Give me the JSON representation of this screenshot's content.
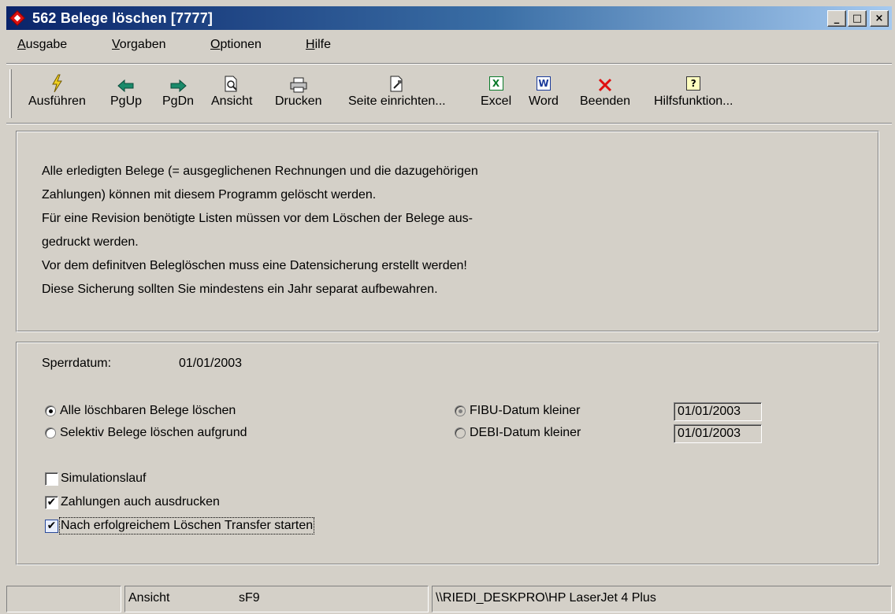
{
  "window": {
    "title": "562 Belege löschen [7777]",
    "controls": {
      "minimize": "_",
      "maximize": "□",
      "close": "×"
    }
  },
  "menu": {
    "items": [
      {
        "label": "Ausgabe",
        "accel": "A",
        "rest": "usgabe"
      },
      {
        "label": "Vorgaben",
        "accel": "V",
        "rest": "orgaben"
      },
      {
        "label": "Optionen",
        "accel": "O",
        "rest": "ptionen"
      },
      {
        "label": "Hilfe",
        "accel": "H",
        "rest": "ilfe"
      }
    ]
  },
  "toolbar": {
    "buttons": [
      {
        "label": "Ausführen",
        "icon": "lightning-icon"
      },
      {
        "label": "PgUp",
        "icon": "arrow-left-icon"
      },
      {
        "label": "PgDn",
        "icon": "arrow-right-icon"
      },
      {
        "label": "Ansicht",
        "icon": "print-preview-icon"
      },
      {
        "label": "Drucken",
        "icon": "printer-icon"
      },
      {
        "label": "Seite einrichten...",
        "icon": "page-setup-icon"
      },
      {
        "label": "Excel",
        "icon": "excel-icon"
      },
      {
        "label": "Word",
        "icon": "word-icon"
      },
      {
        "label": "Beenden",
        "icon": "close-x-icon"
      },
      {
        "label": "Hilfsfunktion...",
        "icon": "help-icon"
      }
    ],
    "colors": {
      "arrow": "#0a7a5a",
      "beenden": "#e01010",
      "lightning": "#c8a000"
    }
  },
  "info": {
    "lines": [
      "Alle erledigten Belege (= ausgeglichenen Rechnungen und die dazugehörigen",
      "Zahlungen) können mit diesem Programm gelöscht werden.",
      "Für eine Revision benötigte Listen müssen vor dem Löschen der Belege aus-",
      "gedruckt werden.",
      "Vor dem definitven Beleglöschen muss eine Datensicherung erstellt werden!",
      "Diese Sicherung sollten Sie mindestens ein Jahr separat aufbewahren."
    ]
  },
  "options": {
    "sperrdatum_label": "Sperrdatum:",
    "sperrdatum_value": "01/01/2003",
    "mode": {
      "all_label": "Alle löschbaren Belege löschen",
      "selective_label": "Selektiv Belege löschen aufgrund",
      "selected": "all"
    },
    "criteria": {
      "fibu_label": "FIBU-Datum kleiner",
      "fibu_value": "01/01/2003",
      "debi_label": "DEBI-Datum kleiner",
      "debi_value": "01/01/2003",
      "selected": "fibu"
    },
    "checks": {
      "simulation_label": "Simulationslauf",
      "simulation_checked": false,
      "zahlungen_label": "Zahlungen auch ausdrucken",
      "zahlungen_checked": true,
      "transfer_label": "Nach erfolgreichem Löschen Transfer starten",
      "transfer_checked": true
    }
  },
  "status": {
    "cell1": "",
    "view": "Ansicht",
    "key": "sF9",
    "printer": "\\\\RIEDI_DESKPRO\\HP LaserJet 4 Plus"
  }
}
